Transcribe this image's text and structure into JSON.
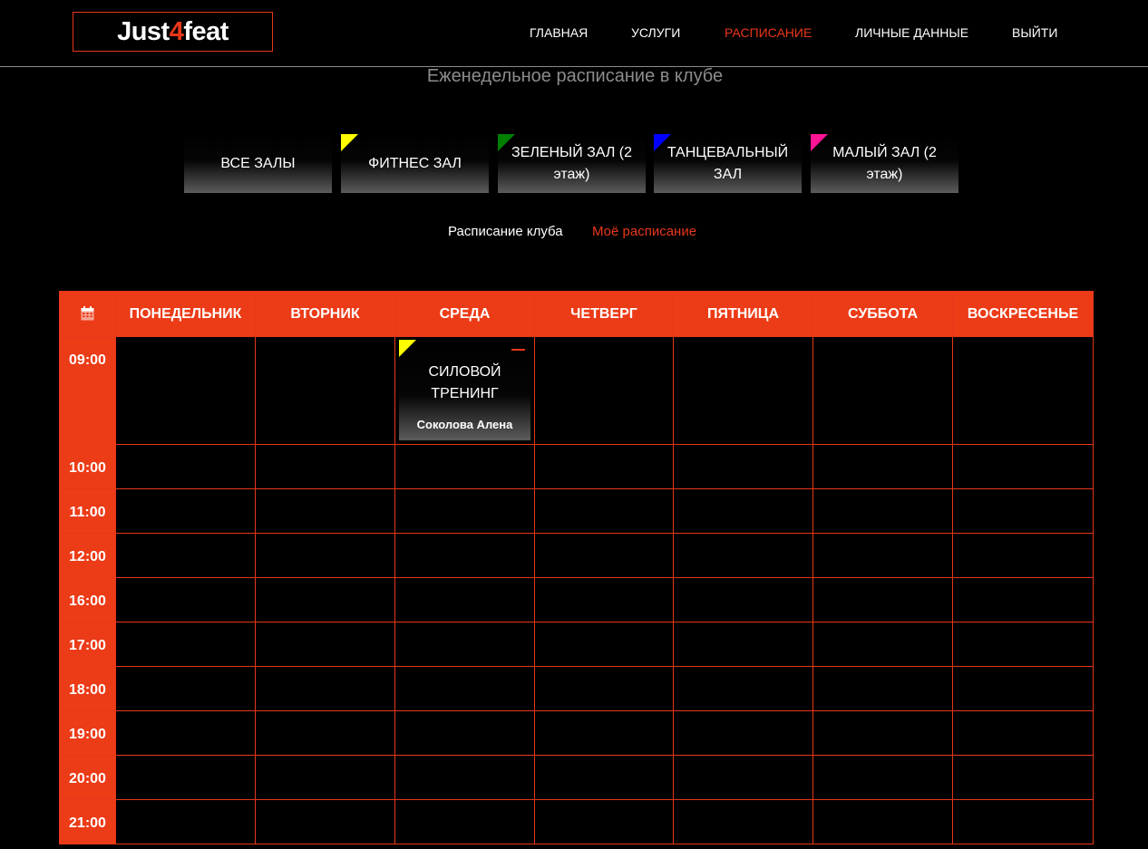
{
  "logo": {
    "part1": "Just",
    "part2": "4",
    "part3": "feat"
  },
  "nav": [
    {
      "label": "ГЛАВНАЯ",
      "active": false
    },
    {
      "label": "УСЛУГИ",
      "active": false
    },
    {
      "label": "РАСПИСАНИЕ",
      "active": true
    },
    {
      "label": "ЛИЧНЫЕ ДАННЫЕ",
      "active": false
    },
    {
      "label": "ВЫЙТИ",
      "active": false
    }
  ],
  "page_title": "Еженедельное расписание в клубе",
  "halls": [
    {
      "label": "ВСЕ ЗАЛЫ",
      "color": null
    },
    {
      "label": "ФИТНЕС ЗАЛ",
      "color": "#ffff00"
    },
    {
      "label": "ЗЕЛЕНЫЙ ЗАЛ (2 этаж)",
      "color": "#008000"
    },
    {
      "label": "ТАНЦЕВАЛЬНЫЙ ЗАЛ",
      "color": "#0000ff"
    },
    {
      "label": "МАЛЫЙ ЗАЛ (2 этаж)",
      "color": "#ff1493"
    }
  ],
  "schedule_toggle": {
    "club": "Расписание клуба",
    "mine": "Моё расписание"
  },
  "timetable": {
    "icon": "calendar-icon",
    "days": [
      "ПОНЕДЕЛЬНИК",
      "ВТОРНИК",
      "СРЕДА",
      "ЧЕТВЕРГ",
      "ПЯТНИЦА",
      "СУББОТА",
      "ВОСКРЕСЕНЬЕ"
    ],
    "times": [
      "09:00",
      "10:00",
      "11:00",
      "12:00",
      "16:00",
      "17:00",
      "18:00",
      "19:00",
      "20:00",
      "21:00"
    ],
    "sessions": [
      {
        "time": "09:00",
        "day": "СРЕДА",
        "name": "СИЛОВОЙ ТРЕНИНГ",
        "trainer": "Соколова Алена",
        "hall_color": "#ffff00"
      }
    ]
  },
  "colors": {
    "accent": "#e8371a",
    "header_fill": "#ec3b17"
  }
}
